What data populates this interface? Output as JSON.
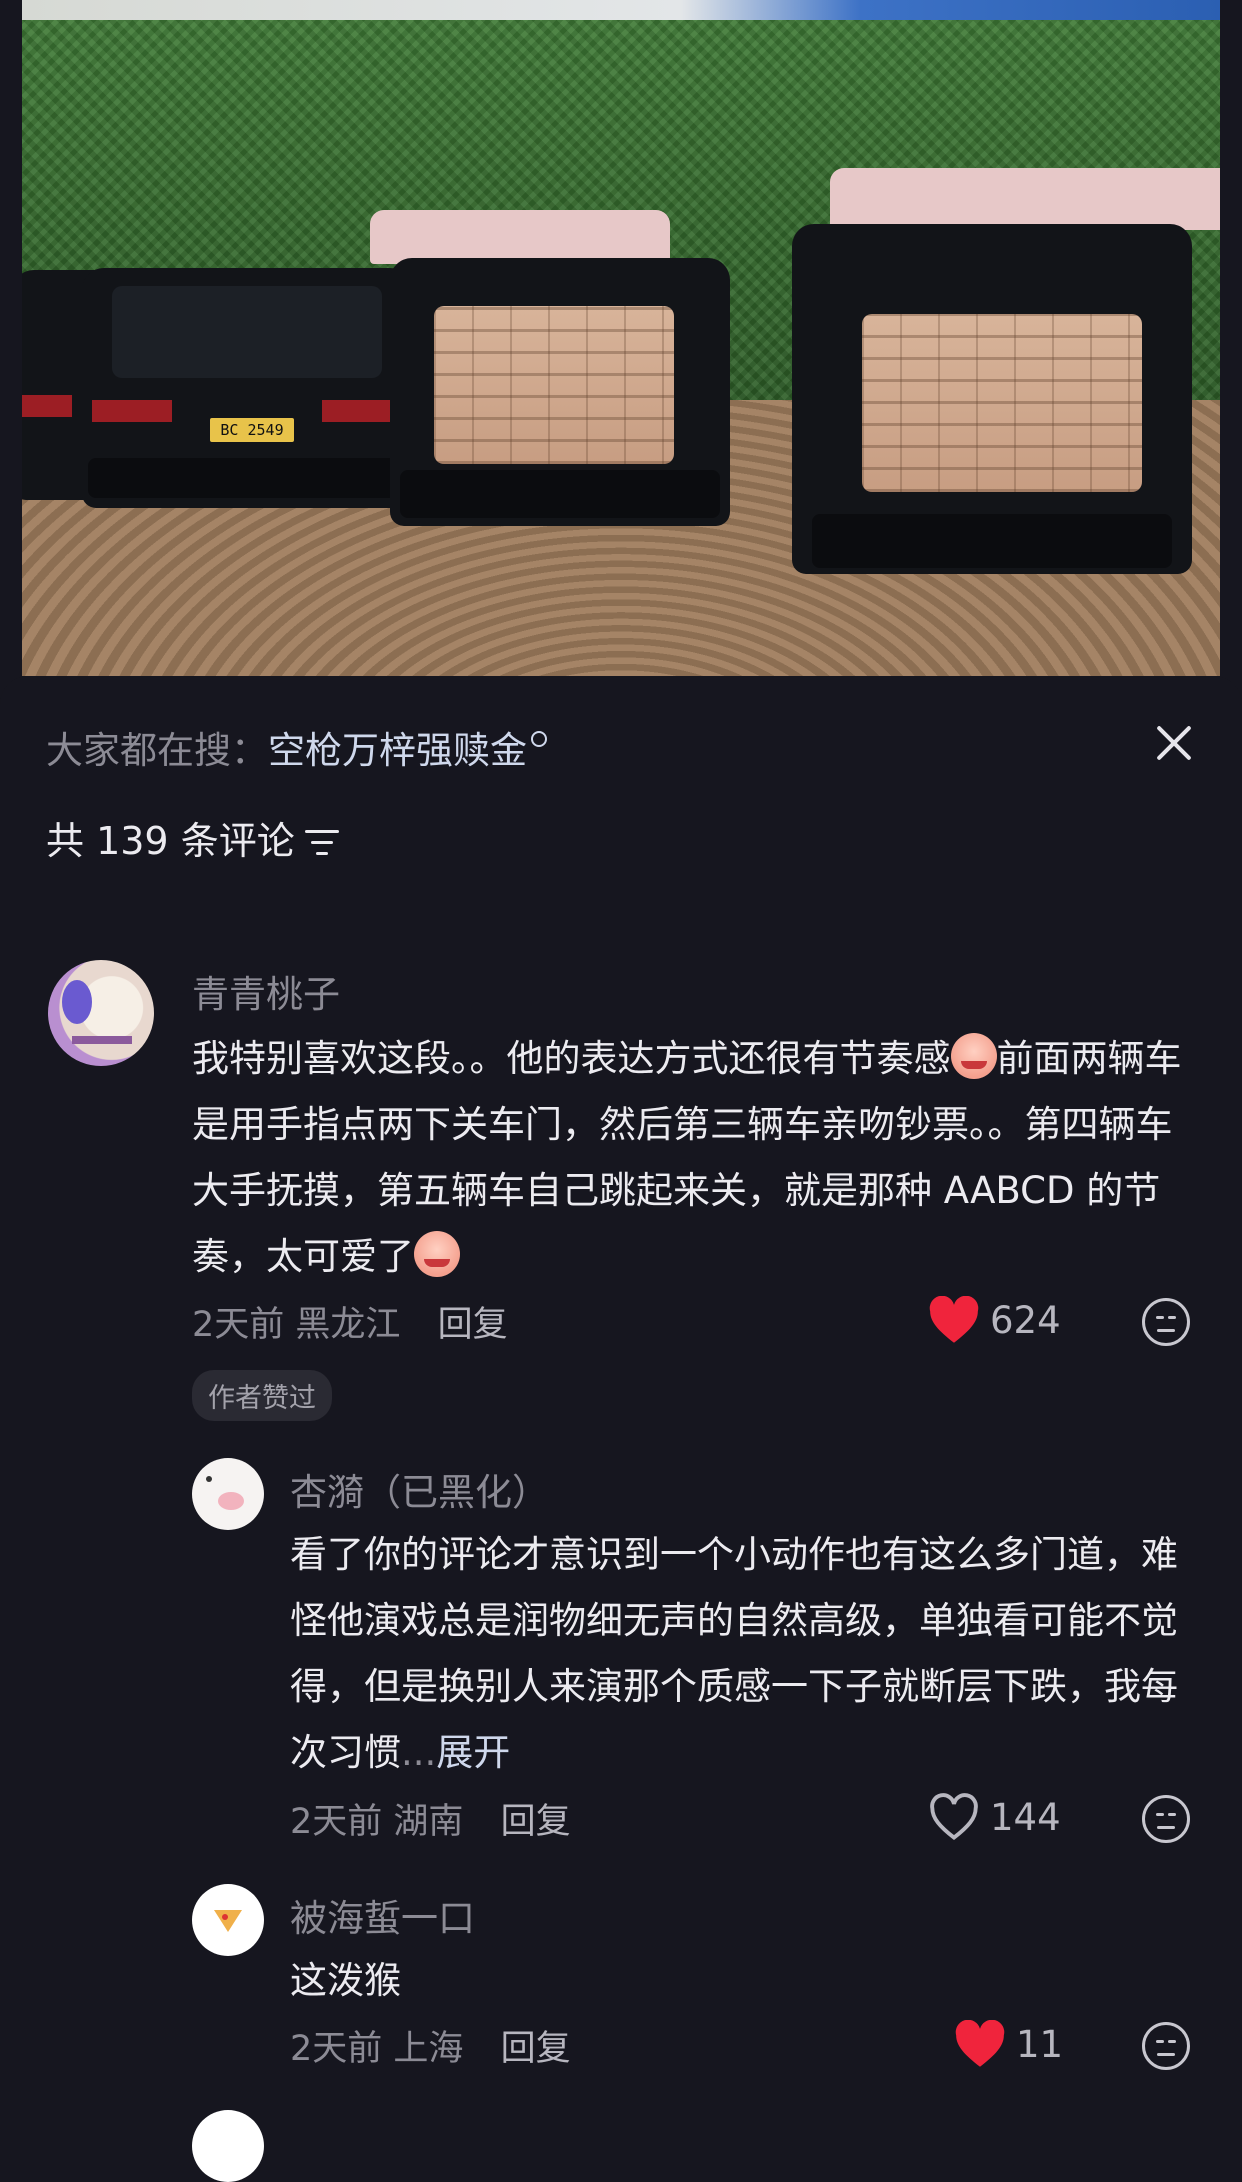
{
  "search": {
    "prefix": "大家都在搜：",
    "query": "空枪万梓强赎金"
  },
  "comments_header": {
    "count_text": "共 139 条评论"
  },
  "video": {
    "plate_text": "BC 2549"
  },
  "comments": [
    {
      "username": "青青桃子",
      "text_part1": "我特别喜欢这段。。他的表达方式还很有节奏感",
      "text_part2": "前面两辆车是用手指点两下关车门，然后第三辆车亲吻钞票。。第四辆车大手抚摸，第五辆车自己跳起来关，就是那种 AABCD 的节奏，太可爱了",
      "time": "2天前",
      "location": "黑龙江",
      "reply_label": "回复",
      "likes": "624",
      "liked": true,
      "badge": "作者赞过"
    },
    {
      "username": "杏漪（已黑化）",
      "text": "看了你的评论才意识到一个小动作也有这么多门道，难怪他演戏总是润物细无声的自然高级，单独看可能不觉得，但是换别人来演那个质感一下子就断层下跌，我每次习惯",
      "ellipsis": "...",
      "expand_label": "展开",
      "time": "2天前",
      "location": "湖南",
      "reply_label": "回复",
      "likes": "144",
      "liked": false
    },
    {
      "username": "被海蜇一口",
      "text": "这泼猴",
      "time": "2天前",
      "location": "上海",
      "reply_label": "回复",
      "likes": "11",
      "liked": true
    }
  ],
  "colors": {
    "background": "#16161f",
    "heart_red": "#f0243c",
    "muted_text": "#8c8b95",
    "search_query": "#cfd8ec"
  }
}
